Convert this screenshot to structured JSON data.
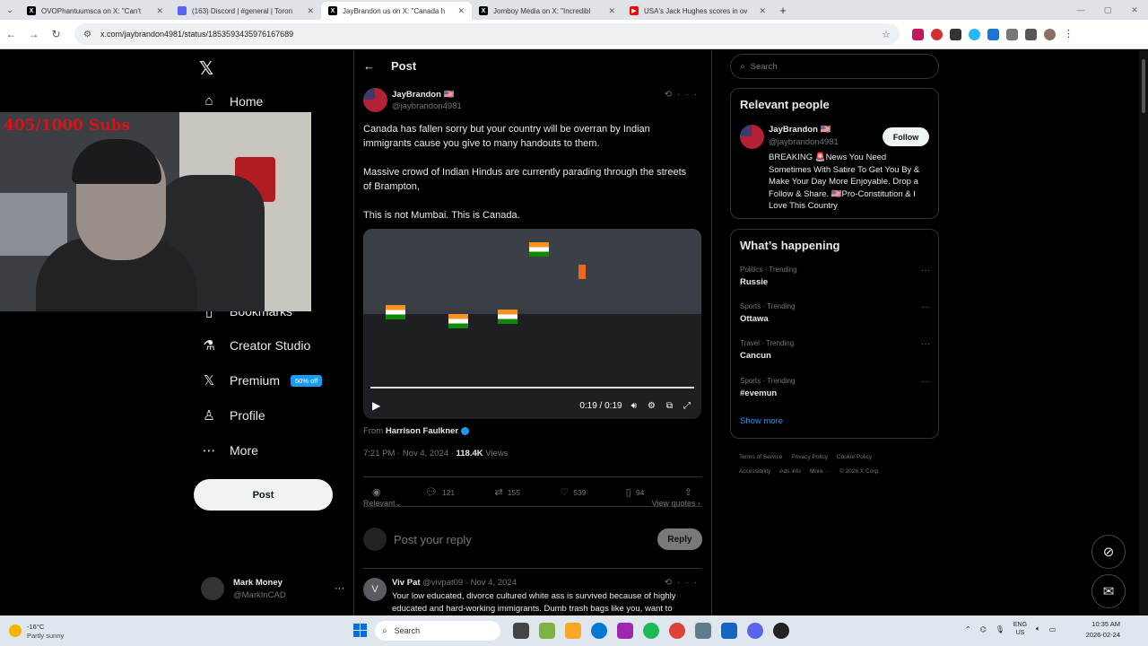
{
  "browser": {
    "tabs": [
      {
        "title": "OVOPhantuumsca on X: \"Can't",
        "icon": "x-favicon",
        "color": "#000000",
        "active": false
      },
      {
        "title": "(163) Discord | #general | Toron",
        "icon": "discord-favicon",
        "color": "#5865f2",
        "active": false
      },
      {
        "title": "JayBrandon us on X: \"Canada h",
        "icon": "x-favicon",
        "color": "#000000",
        "active": true
      },
      {
        "title": "Jomboy Media on X: \"Incredibl",
        "icon": "x-favicon",
        "color": "#000000",
        "active": false
      },
      {
        "title": "USA's Jack Hughes scores in ov",
        "icon": "youtube-favicon",
        "color": "#ff0000",
        "active": false
      }
    ],
    "url": "x.com/jaybrandon4981/status/1853593435976167689"
  },
  "nav": {
    "home": "Home",
    "bookmarks": "Bookmarks",
    "creator_studio": "Creator Studio",
    "premium": "Premium",
    "premium_badge": "50% off",
    "profile": "Profile",
    "more": "More",
    "post_button": "Post",
    "account_name": "Mark Money",
    "account_handle": "@MarkInCAD"
  },
  "webcam": {
    "overlay_text": "405/1000 Subs"
  },
  "main": {
    "header": "Post",
    "author_name": "JayBrandon 🇺🇸",
    "author_handle": "@jaybrandon4981",
    "text_p1": "Canada has fallen sorry but your country will be overran by Indian immigrants cause you give to many handouts to them.",
    "text_p2": "Massive crowd of Indian Hindus are currently parading through the streets of Brampton,",
    "text_p3": "This is not Mumbai. This is Canada.",
    "video_time": "0:19 / 0:19",
    "video_progress": 1.0,
    "from_label": "From",
    "from_name": "Harrison Faulkner",
    "timestamp": "7:21 PM · Nov 4, 2024 · ",
    "views_count": "118.4K",
    "views_label": " Views",
    "replies": "121",
    "reposts": "155",
    "likes": "539",
    "bookmarks": "94",
    "sort_label": "Relevant",
    "view_quotes": "View quotes",
    "reply_placeholder": "Post your reply",
    "reply_button": "Reply"
  },
  "reply": {
    "avatar_letter": "V",
    "name": "Viv Pat",
    "meta": " @vivpat09 · Nov 4, 2024",
    "text": "Your low educated, divorce cultured white ass is survived because of highly educated and hard-working immigrants. Dumb trash bags like you, want to"
  },
  "sidebar": {
    "search_placeholder": "Search",
    "relevant_title": "Relevant people",
    "rp_name": "JayBrandon 🇺🇸",
    "rp_handle": "@jaybrandon4981",
    "follow": "Follow",
    "rp_bio": "BREAKING 🚨News You Need Sometimes With Satire To Get You By & Make Your Day More Enjoyable. Drop a Follow & Share. 🇺🇸Pro-Constitution & I Love This Country",
    "happening_title": "What’s happening",
    "trends": [
      {
        "category": "Politics · Trending",
        "name": "Russie"
      },
      {
        "category": "Sports · Trending",
        "name": "Ottawa"
      },
      {
        "category": "Travel · Trending",
        "name": "Cancun"
      },
      {
        "category": "Sports · Trending",
        "name": "#evemun"
      }
    ],
    "show_more": "Show more",
    "footer": [
      "Terms of Service",
      "Privacy Policy",
      "Cookie Policy",
      "Accessibility",
      "Ads info",
      "More ···",
      "© 2026 X Corp."
    ]
  },
  "taskbar": {
    "temp": "-16°C",
    "weather": "Partly sunny",
    "search": "Search",
    "lang1": "ENG",
    "lang2": "US",
    "time": "10:35 AM",
    "date": "2026-02-24"
  }
}
